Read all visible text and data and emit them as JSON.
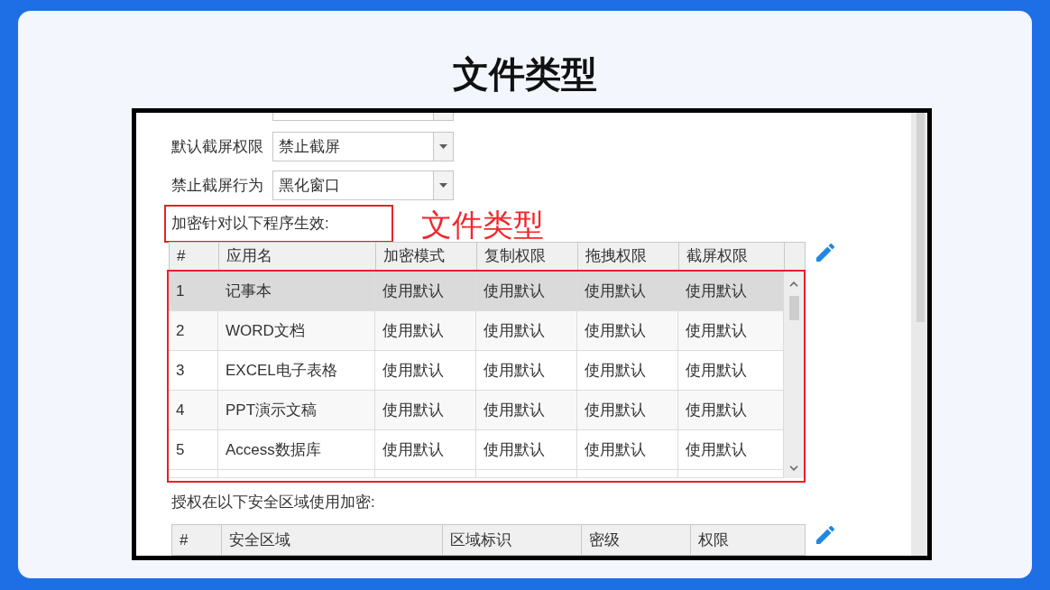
{
  "title": "文件类型",
  "screenshot": {
    "settings": [
      {
        "label": "默认截屏权限",
        "value": "禁止截屏"
      },
      {
        "label": "禁止截屏行为",
        "value": "黑化窗口"
      }
    ],
    "apps_label": "加密针对以下程序生效:",
    "annotation": "文件类型",
    "apps_table": {
      "columns": [
        "#",
        "应用名",
        "加密模式",
        "复制权限",
        "拖拽权限",
        "截屏权限"
      ],
      "rows": [
        {
          "selected": true,
          "cells": [
            "1",
            "记事本",
            "使用默认",
            "使用默认",
            "使用默认",
            "使用默认"
          ]
        },
        {
          "selected": false,
          "cells": [
            "2",
            "WORD文档",
            "使用默认",
            "使用默认",
            "使用默认",
            "使用默认"
          ]
        },
        {
          "selected": false,
          "cells": [
            "3",
            "EXCEL电子表格",
            "使用默认",
            "使用默认",
            "使用默认",
            "使用默认"
          ]
        },
        {
          "selected": false,
          "cells": [
            "4",
            "PPT演示文稿",
            "使用默认",
            "使用默认",
            "使用默认",
            "使用默认"
          ]
        },
        {
          "selected": false,
          "cells": [
            "5",
            "Access数据库",
            "使用默认",
            "使用默认",
            "使用默认",
            "使用默认"
          ]
        }
      ]
    },
    "zones_label": "授权在以下安全区域使用加密:",
    "zones_table": {
      "columns": [
        "#",
        "安全区域",
        "区域标识",
        "密级",
        "权限"
      ]
    }
  }
}
